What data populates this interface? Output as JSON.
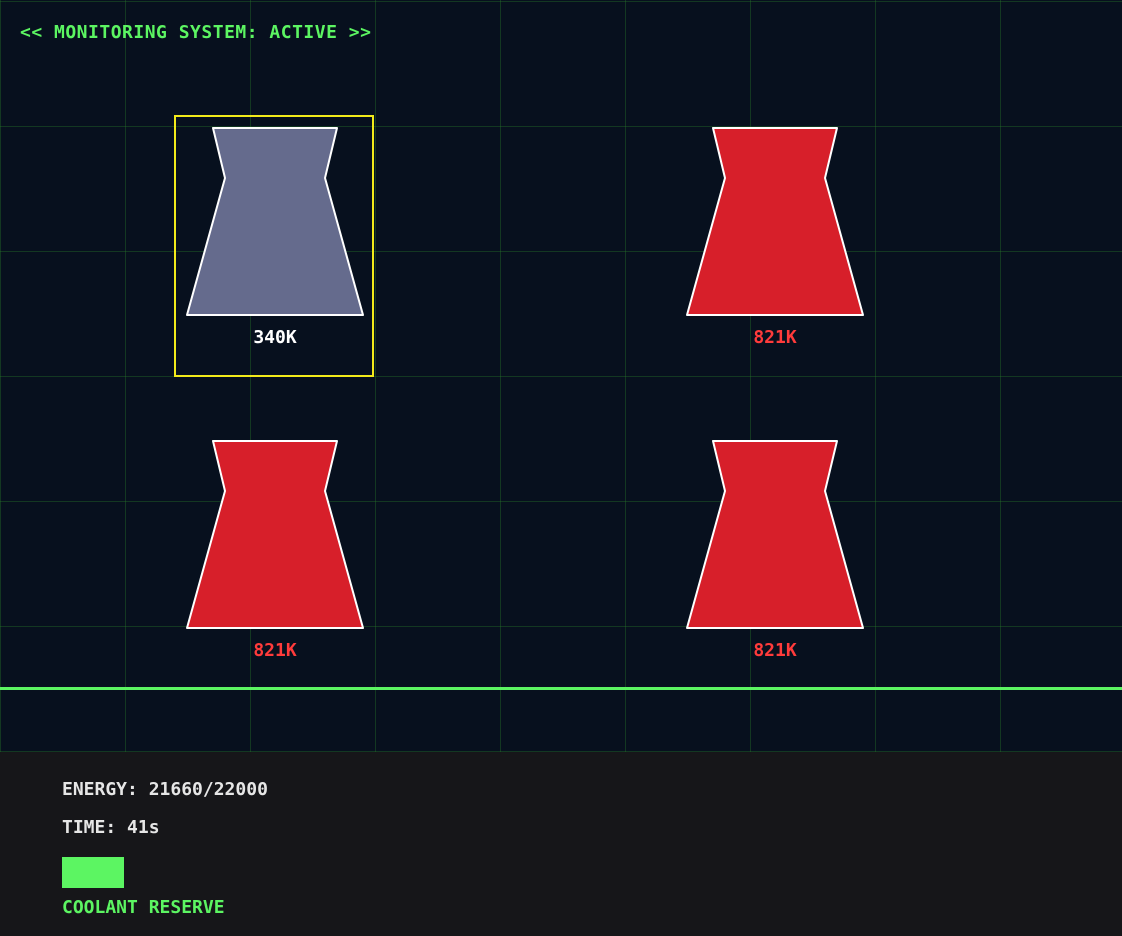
{
  "header": {
    "status_text": "<< MONITORING SYSTEM: ACTIVE >>"
  },
  "colors": {
    "accent_green": "#5cf562",
    "selection_yellow": "#f2ea1a",
    "reactor_cool": "#656b8d",
    "reactor_hot": "#d71f2a",
    "label_cool": "#ffffff",
    "label_hot": "#ff3b3b",
    "background": "#07101e",
    "hud_background": "#161619"
  },
  "reactors": [
    {
      "temp_label": "340K",
      "state": "cool",
      "selected": true
    },
    {
      "temp_label": "821K",
      "state": "hot",
      "selected": false
    },
    {
      "temp_label": "821K",
      "state": "hot",
      "selected": false
    },
    {
      "temp_label": "821K",
      "state": "hot",
      "selected": false
    }
  ],
  "hud": {
    "energy_text": "ENERGY: 21660/22000",
    "time_text": "TIME: 41s",
    "coolant_reserve_level": 1.0,
    "coolant_label": "COOLANT RESERVE"
  }
}
